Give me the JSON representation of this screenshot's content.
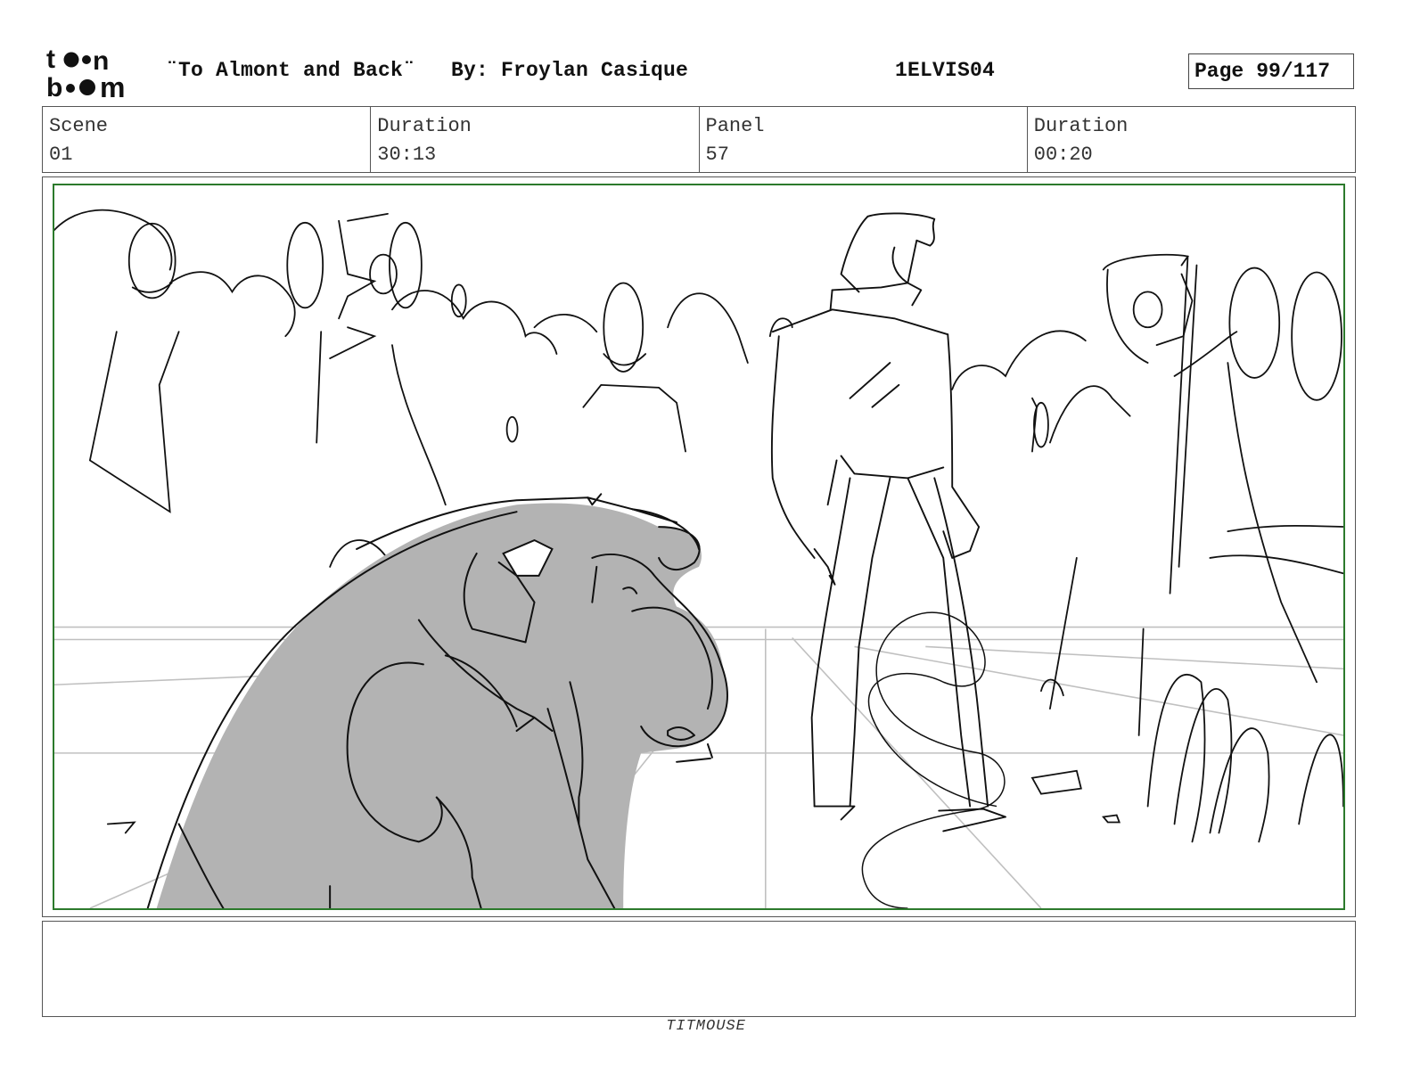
{
  "header": {
    "logo_text": "toon boom",
    "title": "¨To Almont and Back¨",
    "author": "By: Froylan Casique",
    "episode_code": "1ELVIS04",
    "page_label": "Page",
    "page_number": "99/117"
  },
  "info": {
    "scene_label": "Scene",
    "scene_value": "01",
    "scene_duration_label": "Duration",
    "scene_duration_value": "30:13",
    "panel_label": "Panel",
    "panel_value": "57",
    "panel_duration_label": "Duration",
    "panel_duration_value": "00:20"
  },
  "dialog": {
    "text": ""
  },
  "footer": {
    "studio": "TITMOUSE"
  },
  "colors": {
    "safe_frame": "#2c7a2c",
    "gorilla_fill": "#b3b3b3",
    "sketch_line": "#111111",
    "guide_line": "#c0c0c0"
  }
}
